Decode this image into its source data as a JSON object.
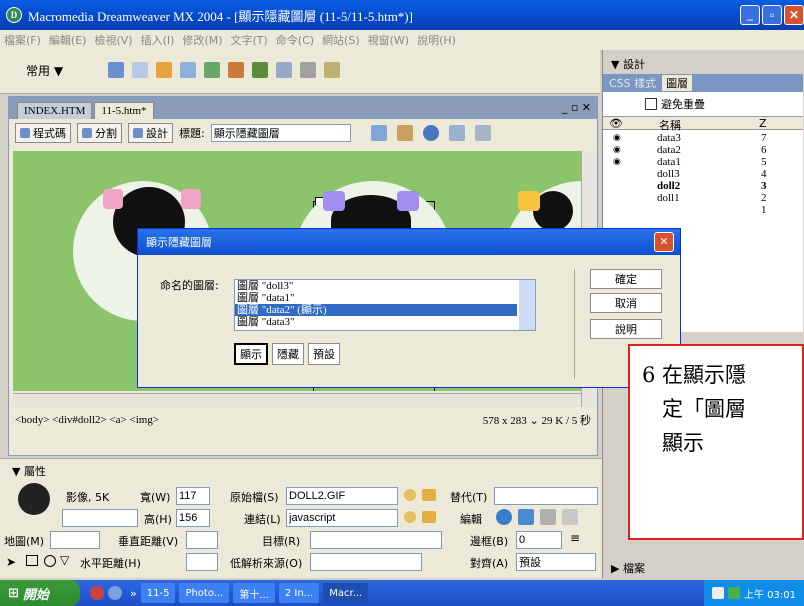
{
  "window": {
    "title": "Macromedia Dreamweaver MX 2004 - [顯示隱藏圖層 (11-5/11-5.htm*)]"
  },
  "menu": [
    "檔案(F)",
    "編輯(E)",
    "檢視(V)",
    "插入(I)",
    "修改(M)",
    "文字(T)",
    "命令(C)",
    "網站(S)",
    "視窗(W)",
    "說明(H)"
  ],
  "insert_bar": {
    "category": "常用"
  },
  "doc": {
    "tabs": [
      "INDEX.HTM",
      "11-5.htm*"
    ],
    "views": [
      "程式碼",
      "分割",
      "設計"
    ],
    "title_label": "標題:",
    "title_value": "顯示隱藏圖層",
    "tag_selector": "<body> <div#doll2> <a> <img>",
    "size_info": "578 x 283 ⌄ 29 K / 5 秒"
  },
  "properties": {
    "header": "▼ 屬性",
    "image_label": "影像, 5K",
    "width_label": "寬(W)",
    "width_value": "117",
    "height_label": "高(H)",
    "height_value": "156",
    "src_label": "原始檔(S)",
    "src_value": "DOLL2.GIF",
    "link_label": "連結(L)",
    "link_value": "javascript",
    "alt_label": "替代(T)",
    "edit_label": "編輯",
    "map_label": "地圖(M)",
    "vspace_label": "垂直距離(V)",
    "target_label": "目標(R)",
    "border_label": "邊框(B)",
    "border_value": "0",
    "hspace_label": "水平距離(H)",
    "lowsrc_label": "低解析來源(O)",
    "align_label": "對齊(A)",
    "align_value": "預設"
  },
  "right_panel": {
    "group": "▼ 設計",
    "tabs": [
      "CSS 樣式",
      "圖層"
    ],
    "prevent_overlap": "避免重疊",
    "col_name": "名稱",
    "col_z": "Z",
    "layers": [
      {
        "name": "data3",
        "z": "7"
      },
      {
        "name": "data2",
        "z": "6"
      },
      {
        "name": "data1",
        "z": "5"
      },
      {
        "name": "doll3",
        "z": "4"
      },
      {
        "name": "doll2",
        "z": "3"
      },
      {
        "name": "doll1",
        "z": "2"
      },
      {
        "name": "",
        "z": "1"
      }
    ],
    "files_group": "▶ 檔案"
  },
  "dialog": {
    "title": "顯示隱藏圖層",
    "named_layers_label": "命名的圖層:",
    "list": [
      "圖層 \"doll3\"",
      "圖層 \"data1\"",
      "圖層 \"data2\" (顯示)",
      "圖層 \"data3\""
    ],
    "selected_index": 2,
    "show_btn": "顯示",
    "hide_btn": "隱藏",
    "default_btn": "預設",
    "ok_btn": "確定",
    "cancel_btn": "取消",
    "help_btn": "說明"
  },
  "annotation": {
    "line1": "6 在顯示隱",
    "line2": "定「圖層",
    "line3": "顯示"
  },
  "taskbar": {
    "start": "開始",
    "tasks": [
      "11-5",
      "Photo...",
      "第十...",
      "2 In...",
      "Macr..."
    ],
    "clock": "上午 03:01"
  },
  "colors": {
    "title_blue": "#0548c8",
    "annotation_border": "#e0211b",
    "taskbar_blue": "#245edb",
    "selection": "#316ac5"
  }
}
